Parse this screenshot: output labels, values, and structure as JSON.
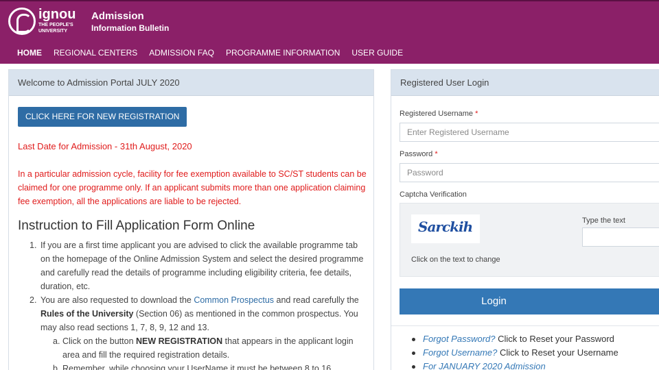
{
  "header": {
    "logo_word": "ignou",
    "logo_sub": "THE PEOPLE'S UNIVERSITY",
    "title_line1": "Admission",
    "title_line2": "Information Bulletin",
    "brand_color": "#8b2068"
  },
  "nav": {
    "items": [
      {
        "label": "HOME"
      },
      {
        "label": "REGIONAL CENTERS"
      },
      {
        "label": "ADMISSION FAQ"
      },
      {
        "label": "PROGRAMME INFORMATION"
      },
      {
        "label": "USER GUIDE"
      }
    ]
  },
  "welcome": {
    "heading": "Welcome to Admission Portal JULY 2020",
    "register_button": "CLICK HERE FOR NEW REGISTRATION",
    "last_date": "Last Date for Admission - 31th August, 2020",
    "warning": "In a particular admission cycle, facility for fee exemption available to SC/ST students can be claimed for one programme only. If an applicant submits more than one application claiming fee exemption, all the applications are liable to be rejected.",
    "instructions_title": "Instruction to Fill Application Form Online",
    "item1_num": "1.",
    "item1_text": "If you are a first time applicant you are advised to click the available programme tab on the homepage of the Online Admission System and select the desired programme and carefully read the details of programme including eligibility criteria, fee details, duration, etc.",
    "item2_num": "2.",
    "item2_pre": "You are also requested to download the ",
    "item2_link": "Common Prospectus",
    "item2_mid": " and read carefully the ",
    "item2_bold": "Rules of the University",
    "item2_post": " (Section 06) as mentioned in the common prospectus. You may also read sections 1, 7, 8, 9, 12 and 13.",
    "sub_a_num": "a.",
    "sub_a_pre": "Click on the button ",
    "sub_a_bold": "NEW REGISTRATION",
    "sub_a_post": " that appears in the applicant login area and fill the required registration details.",
    "sub_b_num": "b.",
    "sub_b_text": "Remember, while choosing your UserName it must be between 8 to 16"
  },
  "login": {
    "heading": "Registered User Login",
    "username_label": "Registered Username",
    "username_placeholder": "Enter Registered Username",
    "password_label": "Password",
    "password_placeholder": "Password",
    "required_mark": "*",
    "captcha_label": "Captcha Verification",
    "captcha_text": "Sarckih",
    "captcha_hint": "Click on the text to change",
    "type_text_label": "Type the text",
    "login_button": "Login",
    "accent_color": "#3478b6"
  },
  "help_links": [
    {
      "link": "Forgot Password?",
      "text": " Click to Reset your Password"
    },
    {
      "link": "Forgot Username?",
      "text": " Click to Reset your Username"
    },
    {
      "link": "For JANUARY 2020 Admission",
      "text": ""
    }
  ]
}
